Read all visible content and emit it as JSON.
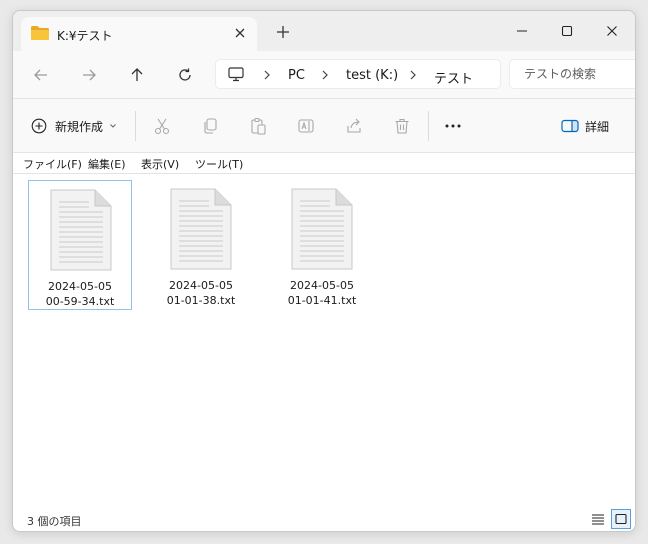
{
  "window": {
    "tab_title": "K:¥テスト",
    "icons": {
      "tab": "folder-icon",
      "tab_close": "close-icon",
      "new_tab": "plus-icon",
      "minimize": "minimize-icon",
      "maximize": "maximize-icon",
      "close": "close-icon"
    }
  },
  "navigation": {
    "buttons": [
      "back-arrow-icon",
      "forward-arrow-icon",
      "up-arrow-icon",
      "refresh-icon"
    ],
    "breadcrumb": [
      "PC",
      "test (K:)",
      "テスト"
    ],
    "search_placeholder": "テストの検索"
  },
  "commandbar": {
    "new_label": "新規作成",
    "details_label": "詳細",
    "icons": [
      "cut-icon",
      "copy-icon",
      "paste-icon",
      "rename-icon",
      "share-icon",
      "delete-icon",
      "more-icon"
    ]
  },
  "menubar": {
    "items": [
      "ファイル(F)",
      "編集(E)",
      "表示(V)",
      "ツール(T)"
    ]
  },
  "files": [
    {
      "line1": "2024-05-05",
      "line2": "00-59-34.txt",
      "selected": true
    },
    {
      "line1": "2024-05-05",
      "line2": "01-01-38.txt",
      "selected": false
    },
    {
      "line1": "2024-05-05",
      "line2": "01-01-41.txt",
      "selected": false
    }
  ],
  "status": {
    "count_text": "3 個の項目",
    "view_modes": [
      "details-view-icon",
      "large-icons-view-icon"
    ],
    "active_view": "large-icons-view-icon"
  },
  "colors": {
    "accent": "#0067c0",
    "selection_border": "#8fc4e8",
    "folder": "#f8c43a"
  }
}
